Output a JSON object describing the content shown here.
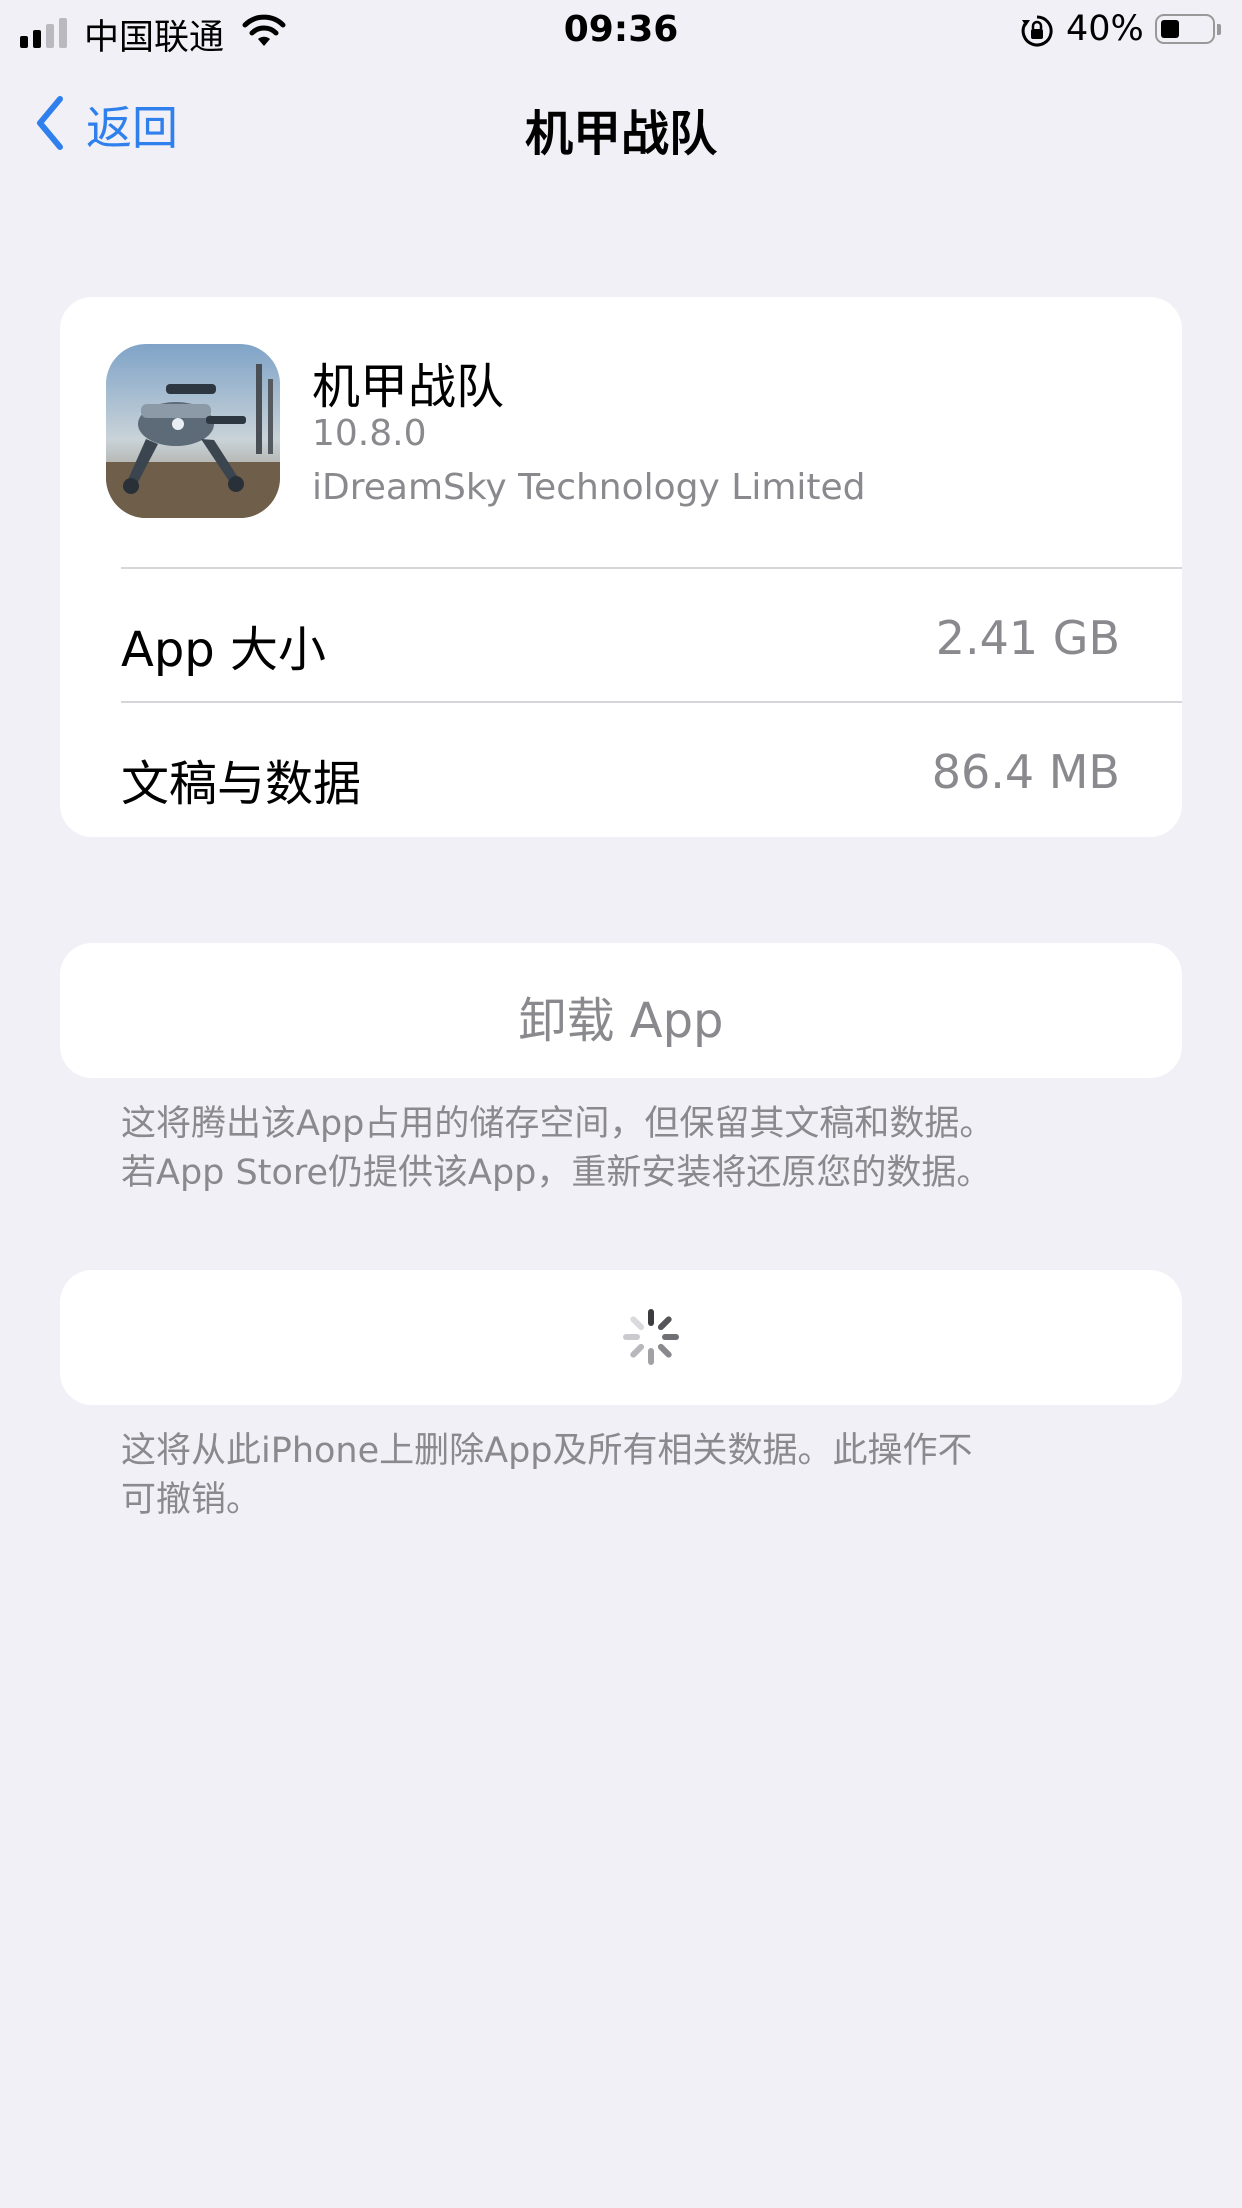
{
  "status_bar": {
    "carrier": "中国联通",
    "time": "09:36",
    "battery_percent": "40%",
    "battery_level": 0.4,
    "signal_bars": 2,
    "icons": [
      "signal-icon",
      "wifi-icon",
      "orientation-lock-icon",
      "battery-icon"
    ]
  },
  "nav": {
    "back_label": "返回",
    "title": "机甲战队"
  },
  "app_info": {
    "name": "机甲战队",
    "version": "10.8.0",
    "developer": "iDreamSky Technology Limited",
    "rows": [
      {
        "label": "App 大小",
        "value": "2.41 GB"
      },
      {
        "label": "文稿与数据",
        "value": "86.4 MB"
      }
    ]
  },
  "offload": {
    "button_label": "卸载 App",
    "footnote_line1": "这将腾出该App占用的储存空间，但保留其文稿和数据。",
    "footnote_line2": "若App Store仍提供该App，重新安装将还原您的数据。"
  },
  "delete": {
    "state_icon": "loading-spinner-icon",
    "footnote_line1": "这将从此iPhone上删除App及所有相关数据。此操作不",
    "footnote_line2": "可撤销。"
  },
  "colors": {
    "background": "#f0f0f6",
    "accent": "#2f80ed",
    "secondary_text": "#8a8a8e"
  }
}
